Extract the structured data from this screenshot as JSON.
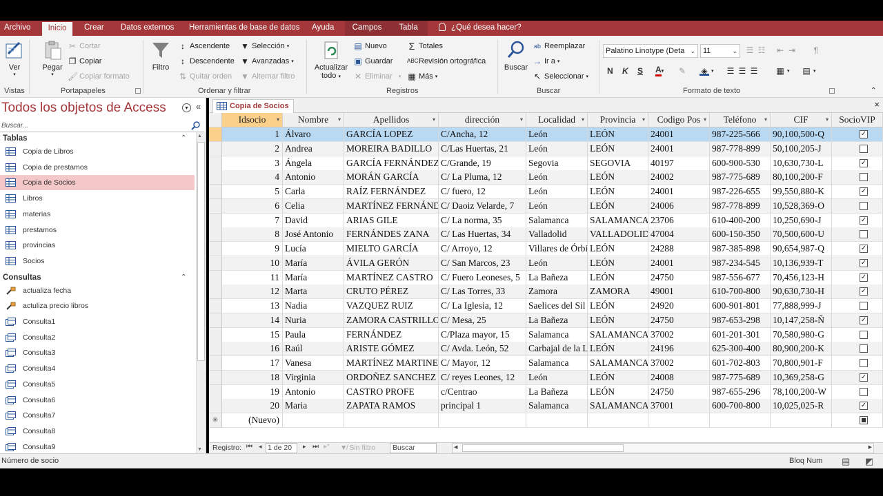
{
  "ribbon_tabs": [
    "Archivo",
    "Inicio",
    "Crear",
    "Datos externos",
    "Herramientas de base de datos",
    "Ayuda",
    "Campos",
    "Tabla",
    "¿Qué desea hacer?"
  ],
  "groups": {
    "vistas": {
      "label": "Vistas",
      "ver": "Ver"
    },
    "portapapeles": {
      "label": "Portapapeles",
      "pegar": "Pegar",
      "cortar": "Cortar",
      "copiar": "Copiar",
      "copiar_formato": "Copiar formato"
    },
    "ordenar": {
      "label": "Ordenar y filtrar",
      "filtro": "Filtro",
      "ascendente": "Ascendente",
      "descendente": "Descendente",
      "quitar_orden": "Quitar orden",
      "seleccion": "Selección",
      "avanzadas": "Avanzadas",
      "alternar_filtro": "Alternar filtro"
    },
    "registros": {
      "label": "Registros",
      "actualizar": "Actualizar",
      "todo": "todo",
      "nuevo": "Nuevo",
      "guardar": "Guardar",
      "eliminar": "Eliminar",
      "totales": "Totales",
      "revision": "Revisión ortográfica",
      "mas": "Más"
    },
    "buscar": {
      "label": "Buscar",
      "buscar": "Buscar",
      "reemplazar": "Reemplazar",
      "ir_a": "Ir a",
      "seleccionar": "Seleccionar"
    },
    "formato": {
      "label": "Formato de texto",
      "font": "Palatino Linotype (Deta",
      "size": "11"
    }
  },
  "nav": {
    "title": "Todos los objetos de Access",
    "search_placeholder": "Buscar...",
    "sections": [
      {
        "name": "Tablas",
        "items": [
          "Copia de Libros",
          "Copia de prestamos",
          "Copia de Socios",
          "Libros",
          "materias",
          "prestamos",
          "provincias",
          "Socios"
        ]
      },
      {
        "name": "Consultas",
        "items": [
          "actualiza fecha",
          "actuliza precio libros",
          "Consulta1",
          "Consulta2",
          "Consulta3",
          "Consulta4",
          "Consulta5",
          "Consulta6",
          "Consulta7",
          "Consulta8",
          "Consulta9"
        ]
      }
    ],
    "selected": "Copia de Socios"
  },
  "document": {
    "tab": "Copia de Socios"
  },
  "table": {
    "columns": [
      "Idsocio",
      "Nombre",
      "Apellidos",
      "dirección",
      "Localidad",
      "Provincia",
      "Codigo Pos",
      "Teléfono",
      "CIF",
      "SocioVIP"
    ],
    "rows": [
      [
        1,
        "Álvaro",
        "GARCÍA LOPEZ",
        "C/Ancha, 12",
        "León",
        "LEÓN",
        "24001",
        "987-225-566",
        "90,100,500-Q",
        true
      ],
      [
        2,
        "Andrea",
        "MOREIRA BADILLO",
        "C/Las Huertas, 21",
        "León",
        "LEÓN",
        "24001",
        "987-778-899",
        "50,100,205-J",
        false
      ],
      [
        3,
        "Ángela",
        "GARCÍA FERNÁNDEZ",
        "C/Grande, 19",
        "Segovia",
        "SEGOVIA",
        "40197",
        "600-900-530",
        "10,630,730-L",
        true
      ],
      [
        4,
        "Antonio",
        "MORÁN GARCÍA",
        "C/ La Pluma, 12",
        "León",
        "LEÓN",
        "24002",
        "987-775-689",
        "80,100,200-F",
        false
      ],
      [
        5,
        "Carla",
        "RAÍZ FERNÁNDEZ",
        "C/ fuero, 12",
        "León",
        "LEÓN",
        "24001",
        "987-226-655",
        "99,550,880-K",
        true
      ],
      [
        6,
        "Celia",
        "MARTÍNEZ FERNÁNDEZ",
        "C/ Daoiz Velarde, 7",
        "León",
        "LEÓN",
        "24006",
        "987-778-899",
        "10,528,369-O",
        false
      ],
      [
        7,
        "David",
        "ARIAS GILE",
        "C/ La norma, 35",
        "Salamanca",
        "SALAMANCA",
        "23706",
        "610-400-200",
        "10,250,690-J",
        true
      ],
      [
        8,
        "José Antonio",
        "FERNÁNDES ZANA",
        "C/ Las Huertas, 34",
        "Valladolid",
        "VALLADOLID",
        "47004",
        "600-150-350",
        "70,500,600-U",
        false
      ],
      [
        9,
        "Lucía",
        "MIELTO GARCÍA",
        "C/ Arroyo, 12",
        "Villares de Órbigo",
        "LEÓN",
        "24288",
        "987-385-898",
        "90,654,987-Q",
        true
      ],
      [
        10,
        "María",
        "ÁVILA GERÓN",
        "C/ San Marcos, 23",
        "León",
        "LEÓN",
        "24001",
        "987-234-545",
        "10,136,939-T",
        true
      ],
      [
        11,
        "María",
        "MARTÍNEZ CASTRO",
        "C/ Fuero Leoneses, 5",
        "La Bañeza",
        "LEÓN",
        "24750",
        "987-556-677",
        "70,456,123-H",
        true
      ],
      [
        12,
        "Marta",
        "CRUTO PÉREZ",
        "C/ Las Torres, 33",
        "Zamora",
        "ZAMORA",
        "49001",
        "610-700-800",
        "90,630,730-H",
        true
      ],
      [
        13,
        "Nadia",
        "VAZQUEZ RUIZ",
        "C/ La Iglesia, 12",
        "Saelices del Sil",
        "LEÓN",
        "24920",
        "600-901-801",
        "77,888,999-J",
        false
      ],
      [
        14,
        "Nuria",
        "ZAMORA CASTRILLO",
        "C/ Mesa, 25",
        "La Bañeza",
        "LEÓN",
        "24750",
        "987-653-298",
        "10,147,258-Ñ",
        true
      ],
      [
        15,
        "Paula",
        "FERNÁNDEZ",
        "C/Plaza mayor, 15",
        "Salamanca",
        "SALAMANCA",
        "37002",
        "601-201-301",
        "70,580,980-G",
        false
      ],
      [
        16,
        "Raúl",
        "ARISTE GÓMEZ",
        "C/ Avda. León, 52",
        "Carbajal de la Legua",
        "LEÓN",
        "24196",
        "625-300-400",
        "80,900,200-K",
        false
      ],
      [
        17,
        "Vanesa",
        "MARTÍNEZ MARTINEZ",
        "C/ Mayor, 12",
        "Salamanca",
        "SALAMANCA",
        "37002",
        "601-702-803",
        "70,800,901-F",
        false
      ],
      [
        18,
        "Virginia",
        "ORDOÑEZ SANCHEZ",
        "C/ reyes Leones, 12",
        "León",
        "LEÓN",
        "24008",
        "987-775-689",
        "10,369,258-G",
        true
      ],
      [
        19,
        "Antonio",
        "CASTRO PROFE",
        "c/Centrao",
        "La Bañeza",
        "LEÓN",
        "24750",
        "987-655-296",
        "78,100,200-W",
        false
      ],
      [
        20,
        "Maria",
        "ZAPATA RAMOS",
        "principal 1",
        "Salamanca",
        "SALAMANCA",
        "37001",
        "600-700-800",
        "10,025,025-R",
        true
      ]
    ],
    "new_row": "(Nuevo)"
  },
  "record_nav": {
    "label": "Registro:",
    "position": "1 de 20",
    "filter": "Sin filtro",
    "search": "Buscar"
  },
  "status": {
    "left": "Número de socio",
    "right": "Bloq Num"
  }
}
